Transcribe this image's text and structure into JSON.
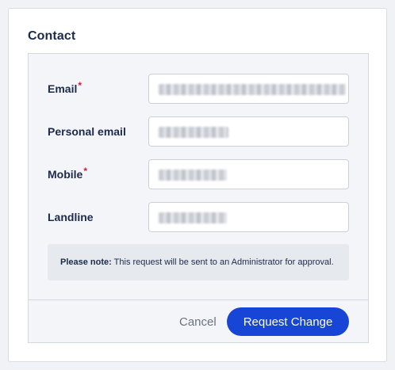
{
  "section": {
    "title": "Contact"
  },
  "fields": [
    {
      "label": "Email",
      "required": "*",
      "value": "",
      "blur_width": 236
    },
    {
      "label": "Personal email",
      "required": "",
      "value": "",
      "blur_width": 88
    },
    {
      "label": "Mobile",
      "required": "*",
      "value": "",
      "blur_width": 86
    },
    {
      "label": "Landline",
      "required": "",
      "value": "",
      "blur_width": 86
    }
  ],
  "note": {
    "prefix": "Please note:",
    "text": " This request will be sent to an Administrator for approval."
  },
  "actions": {
    "cancel_label": "Cancel",
    "submit_label": "Request Change"
  },
  "colors": {
    "primary": "#1746d6",
    "required": "#d2183c",
    "text": "#1c2b4a"
  }
}
